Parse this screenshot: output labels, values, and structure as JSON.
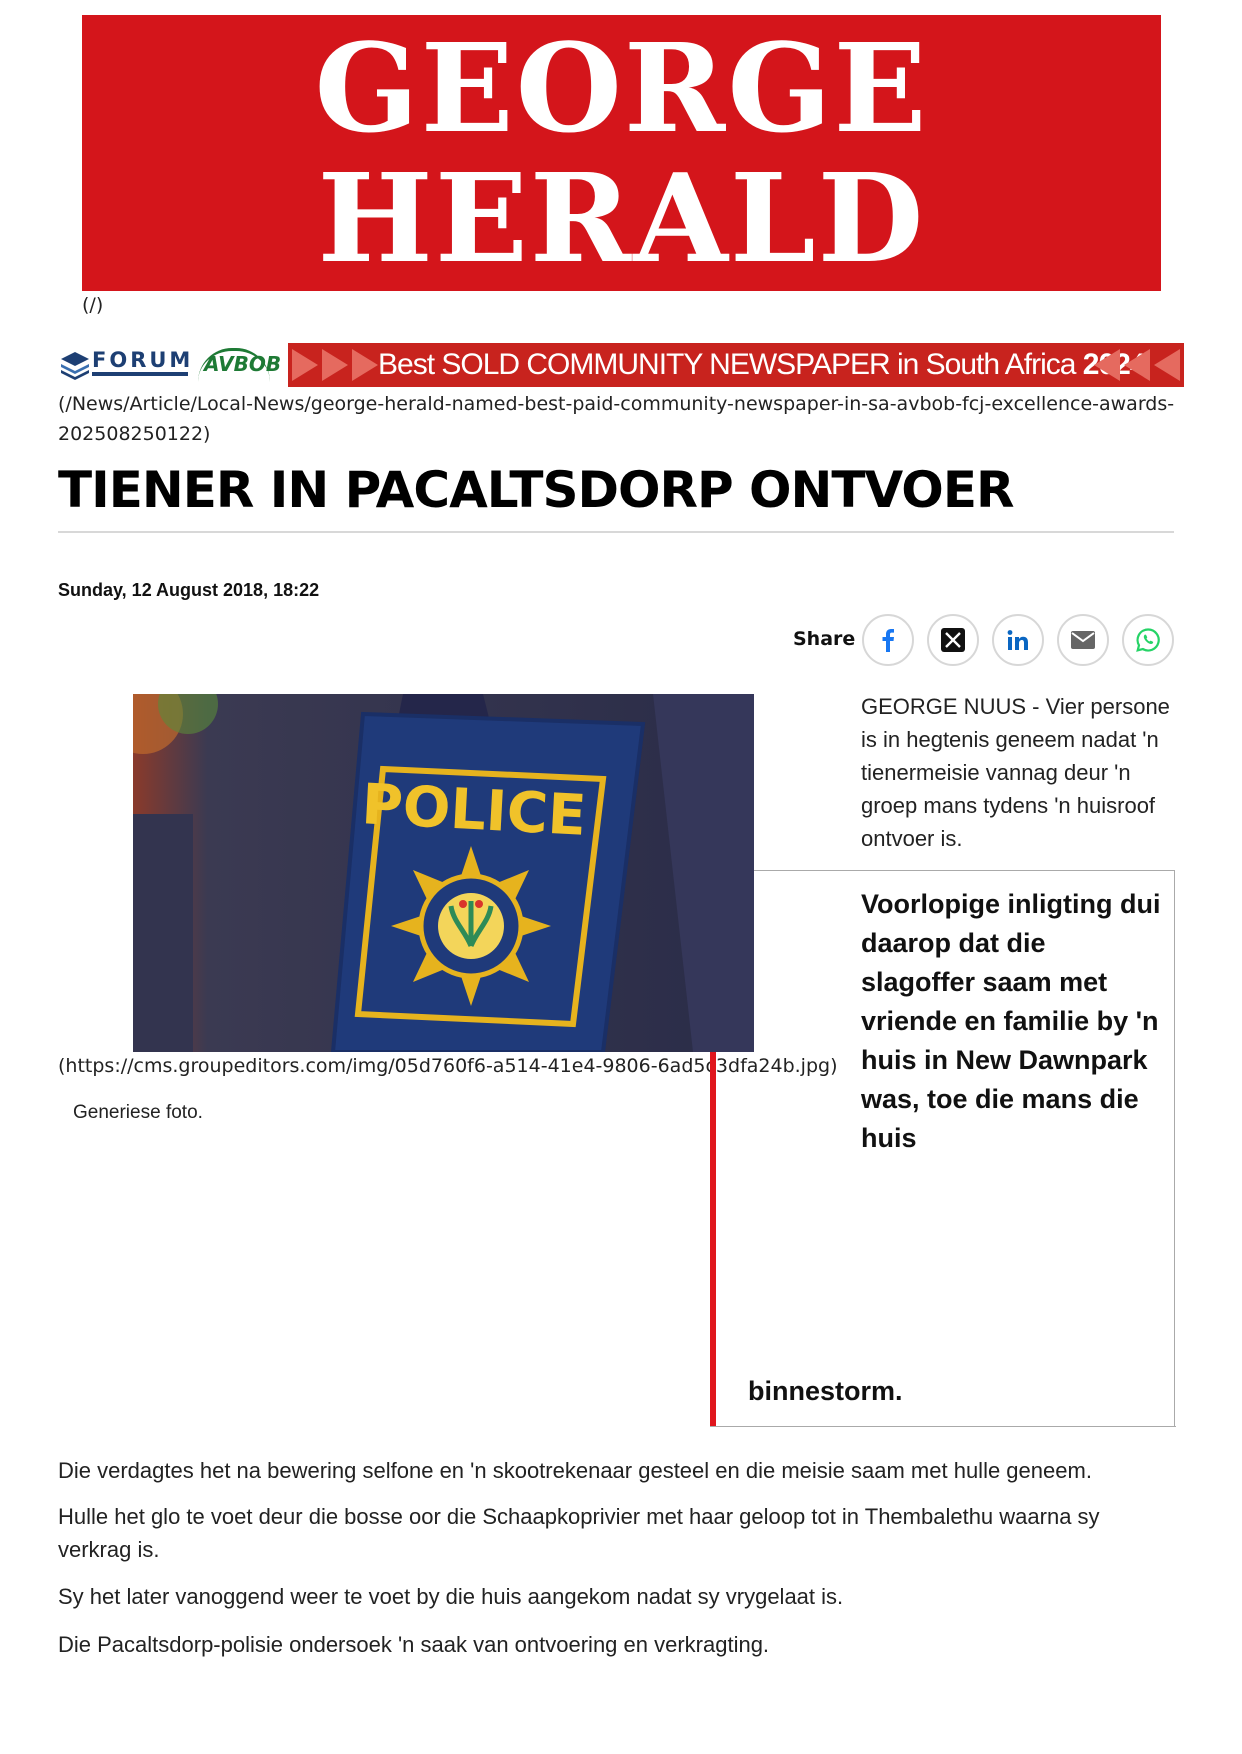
{
  "masthead": {
    "line1": "GEORGE",
    "line2": "HERALD"
  },
  "home_link": "(/)",
  "promo": {
    "forum_logo_text": "FORUM",
    "avbob_logo_text": "AVBOB",
    "banner_text_prefix": "Best SOLD COMMUNITY NEWSPAPER in South Africa",
    "banner_year": "2024",
    "link_url": "(/News/Article/Local-News/george-herald-named-best-paid-community-newspaper-in-sa-avbob-fcj-excellence-awards-202508250122)"
  },
  "article": {
    "headline": "TIENER IN PACALTSDORP ONTVOER",
    "dateline": "Sunday, 12 August 2018, 18:22",
    "share_label": "Share",
    "share_icons": [
      "facebook-icon",
      "x-icon",
      "linkedin-icon",
      "email-icon",
      "whatsapp-icon"
    ],
    "image": {
      "badge_text": "POLICE",
      "url": "(https://cms.groupeditors.com/img/05d760f6-a514-41e4-9806-6ad5c3dfa24b.jpg)",
      "caption": "Generiese foto."
    },
    "intro": "GEORGE NUUS - Vier persone is in hegtenis geneem nadat 'n tienermeisie vannag deur 'n groep mans tydens 'n huisroof ontvoer is.",
    "pullquote": "Voorlopige inligting dui daarop dat die slagoffer saam met vriende en familie by 'n huis in New Dawnpark was, toe die mans die huis",
    "pullquote_end": "binnestorm.",
    "paragraphs": [
      "Die verdagtes het na bewering selfone en 'n skootrekenaar gesteel en die meisie saam met hulle geneem.",
      "Hulle het glo te voet deur die bosse oor die Schaapkoprivier met haar geloop tot in Thembalethu waarna sy verkrag is.",
      "Sy het later vanoggend weer te voet by die huis aangekom nadat sy vrygelaat is.",
      "Die Pacaltsdorp-polisie ondersoek 'n saak van ontvoering en verkragting."
    ]
  },
  "colors": {
    "masthead_red": "#d4151b",
    "banner_red": "#c8231e",
    "accent_red": "#e0161d",
    "forum_blue": "#1d3f73",
    "avbob_green": "#1e7a35"
  }
}
